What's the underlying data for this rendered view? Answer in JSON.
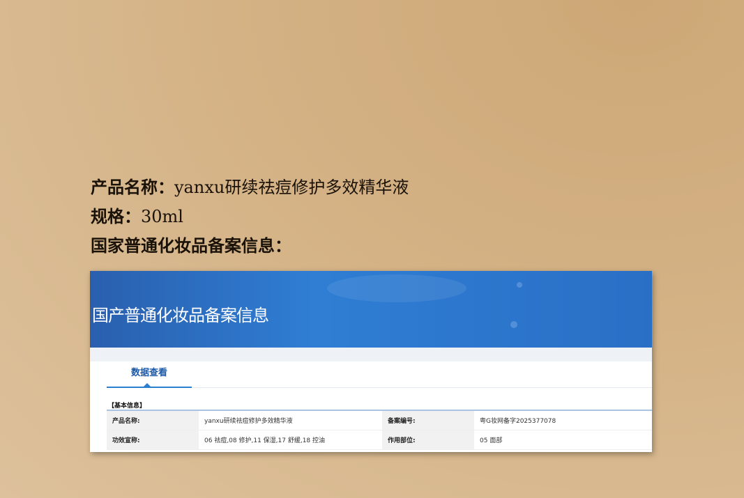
{
  "lines": [
    {
      "label": "产品名称：",
      "value": "yanxu研续祛痘修护多效精华液"
    },
    {
      "label": "规格：",
      "value": "30ml"
    },
    {
      "label": "国家普通化妆品备案信息：",
      "value": ""
    }
  ],
  "screenshot": {
    "banner_title": "国产普通化妆品备案信息",
    "tab": "数据查看",
    "section": "【基本信息】",
    "rows": [
      [
        {
          "label": "产品名称:",
          "value": "yanxu研续祛痘修护多效精华液"
        },
        {
          "label": "备案编号:",
          "value": "粤G妆网备字2025377078"
        }
      ],
      [
        {
          "label": "功效宣称:",
          "value": "06 祛痘,08 修护,11 保湿,17 舒缓,18 控油"
        },
        {
          "label": "作用部位:",
          "value": "05 面部"
        }
      ]
    ]
  }
}
